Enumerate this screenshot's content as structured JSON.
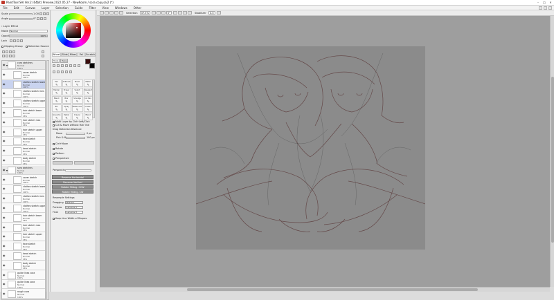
{
  "window": {
    "title": "PaintTool SAI Ver.2 (64bit) Preview.2022.05.27 - NewRoom / sora copy.sai2 (*)"
  },
  "menu": [
    "File",
    "Edit",
    "Canvas",
    "Layer",
    "Selection",
    "Guide",
    "Filter",
    "View",
    "Windows",
    "Other"
  ],
  "brush_panel": {
    "size_label": "Scale",
    "size_value": "1.00",
    "angle_label": "Angle",
    "angle_value": "0°",
    "effect_label": "Layer Effect",
    "mode_label": "Mode",
    "mode_value": "Normal",
    "opacity_label": "Opacity",
    "opacity_value": "100%",
    "lock_label": "Lock",
    "clipping_label": "Clipping Group",
    "selection_source_label": "Selection Source"
  },
  "layers": [
    {
      "name": "cora sketches",
      "mode": "Normal",
      "opacity": "100%",
      "folder": true,
      "indent": false,
      "selected": false
    },
    {
      "name": "cover sketch",
      "mode": "Normal",
      "opacity": "100%",
      "folder": false,
      "indent": true,
      "selected": false
    },
    {
      "name": "clothes sketch lower",
      "mode": "Normal",
      "opacity": "100%",
      "folder": false,
      "indent": true,
      "selected": true
    },
    {
      "name": "clothes sketch mes",
      "mode": "Normal",
      "opacity": "100%",
      "folder": false,
      "indent": true,
      "selected": false
    },
    {
      "name": "clothes sketch upper",
      "mode": "Normal",
      "opacity": "100%",
      "folder": false,
      "indent": true,
      "selected": false
    },
    {
      "name": "hair sketch lower",
      "mode": "Normal",
      "opacity": "46%",
      "folder": false,
      "indent": true,
      "selected": false
    },
    {
      "name": "hair sketch mes",
      "mode": "Normal",
      "opacity": "46%",
      "folder": false,
      "indent": true,
      "selected": false
    },
    {
      "name": "hair sketch upper",
      "mode": "Normal",
      "opacity": "46%",
      "folder": false,
      "indent": true,
      "selected": false
    },
    {
      "name": "face sketch",
      "mode": "Normal",
      "opacity": "46%",
      "folder": false,
      "indent": true,
      "selected": false
    },
    {
      "name": "head sketch",
      "mode": "Normal",
      "opacity": "46%",
      "folder": false,
      "indent": true,
      "selected": false
    },
    {
      "name": "body sketch",
      "mode": "Normal",
      "opacity": "46%",
      "folder": false,
      "indent": true,
      "selected": false
    },
    {
      "name": "sora sketches",
      "mode": "Normal",
      "opacity": "100%",
      "folder": true,
      "indent": false,
      "selected": false
    },
    {
      "name": "cover sketch",
      "mode": "Normal",
      "opacity": "100%",
      "folder": false,
      "indent": true,
      "selected": false
    },
    {
      "name": "clothes sketch lower",
      "mode": "Normal",
      "opacity": "100%",
      "folder": false,
      "indent": true,
      "selected": false
    },
    {
      "name": "clothes sketch mes",
      "mode": "Normal",
      "opacity": "100%",
      "folder": false,
      "indent": true,
      "selected": false
    },
    {
      "name": "clothes sketch upper",
      "mode": "Normal",
      "opacity": "100%",
      "folder": false,
      "indent": true,
      "selected": false
    },
    {
      "name": "hair sketch lower",
      "mode": "Normal",
      "opacity": "46%",
      "folder": false,
      "indent": true,
      "selected": false
    },
    {
      "name": "hair sketch mes",
      "mode": "Normal",
      "opacity": "46%",
      "folder": false,
      "indent": true,
      "selected": false
    },
    {
      "name": "hair sketch upper",
      "mode": "Normal",
      "opacity": "46%",
      "folder": false,
      "indent": true,
      "selected": false
    },
    {
      "name": "face sketch",
      "mode": "Normal",
      "opacity": "46%",
      "folder": false,
      "indent": true,
      "selected": false
    },
    {
      "name": "head sketch",
      "mode": "Normal",
      "opacity": "46%",
      "folder": false,
      "indent": true,
      "selected": false
    },
    {
      "name": "body sketch",
      "mode": "Normal",
      "opacity": "46%",
      "folder": false,
      "indent": true,
      "selected": false
    },
    {
      "name": "guide lines cora",
      "mode": "Normal",
      "opacity": "100%",
      "folder": false,
      "indent": false,
      "selected": false
    },
    {
      "name": "guide lines sora",
      "mode": "Normal",
      "opacity": "100%",
      "folder": false,
      "indent": false,
      "selected": false
    },
    {
      "name": "rough cora",
      "mode": "Normal",
      "opacity": "100%",
      "folder": false,
      "indent": false,
      "selected": false
    }
  ],
  "color_tabs": [
    "Wheel",
    "Slide",
    "Mixer",
    "Pal",
    "Scratch"
  ],
  "colors": {
    "primary": "#3a0c0c",
    "secondary": "#000000",
    "wheel_marker": "#c00000"
  },
  "tool_tabs": [
    "Tools",
    "Pens"
  ],
  "tools": [
    {
      "label": "Pen",
      "icon": "pen-icon"
    },
    {
      "label": "AirBrush",
      "icon": "airbrush-icon"
    },
    {
      "label": "Brush",
      "icon": "brush-icon"
    },
    {
      "label": "Water",
      "icon": "water-icon"
    },
    {
      "label": "Marker",
      "icon": "marker-icon"
    },
    {
      "label": "Eraser",
      "icon": "eraser-icon"
    },
    {
      "label": "Select",
      "icon": "select-icon"
    },
    {
      "label": "Deselect",
      "icon": "deselect-icon"
    },
    {
      "label": "Blend",
      "icon": "blend-icon"
    },
    {
      "label": "Blur",
      "icon": "blur-icon"
    },
    {
      "label": "Smudge",
      "icon": "smudge-icon"
    },
    {
      "label": "Ink Pen",
      "icon": "inkpen-icon"
    },
    {
      "label": "Bin",
      "icon": "bin-icon"
    },
    {
      "label": "Spray",
      "icon": "spray-icon"
    },
    {
      "label": "Watercolor",
      "icon": "watercolor-icon"
    },
    {
      "label": "Lineart",
      "icon": "lineart-icon"
    },
    {
      "label": "Gouache",
      "icon": "gouache-icon"
    },
    {
      "label": "Pastel",
      "icon": "pastel-icon"
    },
    {
      "label": "Crayon",
      "icon": "crayon-icon"
    },
    {
      "label": "Blend",
      "icon": "blend2-icon"
    }
  ],
  "transform": {
    "multi_layer": "Multi Layer by Ctrl+Left/Click",
    "cut_move": "Cut & Move without Hair line",
    "drag_section": "Drag Detection Distance",
    "move_label": "Move",
    "move_value": "0 px",
    "pick_label": "Pick & Move",
    "pick_value": "100 px",
    "check_opts": [
      "Ctrl+Move",
      "Rotate",
      "Deform",
      "Perspective"
    ],
    "perspective_label": "Perspective",
    "buttons": [
      "Reverse Horizontal",
      "Reverse Vertical",
      "Rotate 90deg. CCW",
      "Rotate 90deg. CW"
    ],
    "resample_heading": "Resample Settings",
    "dragging_label": "Dragging",
    "dragging_value": "Bilinear",
    "preview_label": "Preview",
    "preview_value": "Lanczos 3",
    "final_label": "Final",
    "final_value": "Lanczos 3",
    "keep_line": "Keep Line Width of Shapes"
  },
  "toolbar": {
    "selection_label": "Selection",
    "zoom": "37.5%",
    "angle": "0°",
    "stabilizer_label": "Stabilizer",
    "stabilizer_value": "S-5"
  }
}
